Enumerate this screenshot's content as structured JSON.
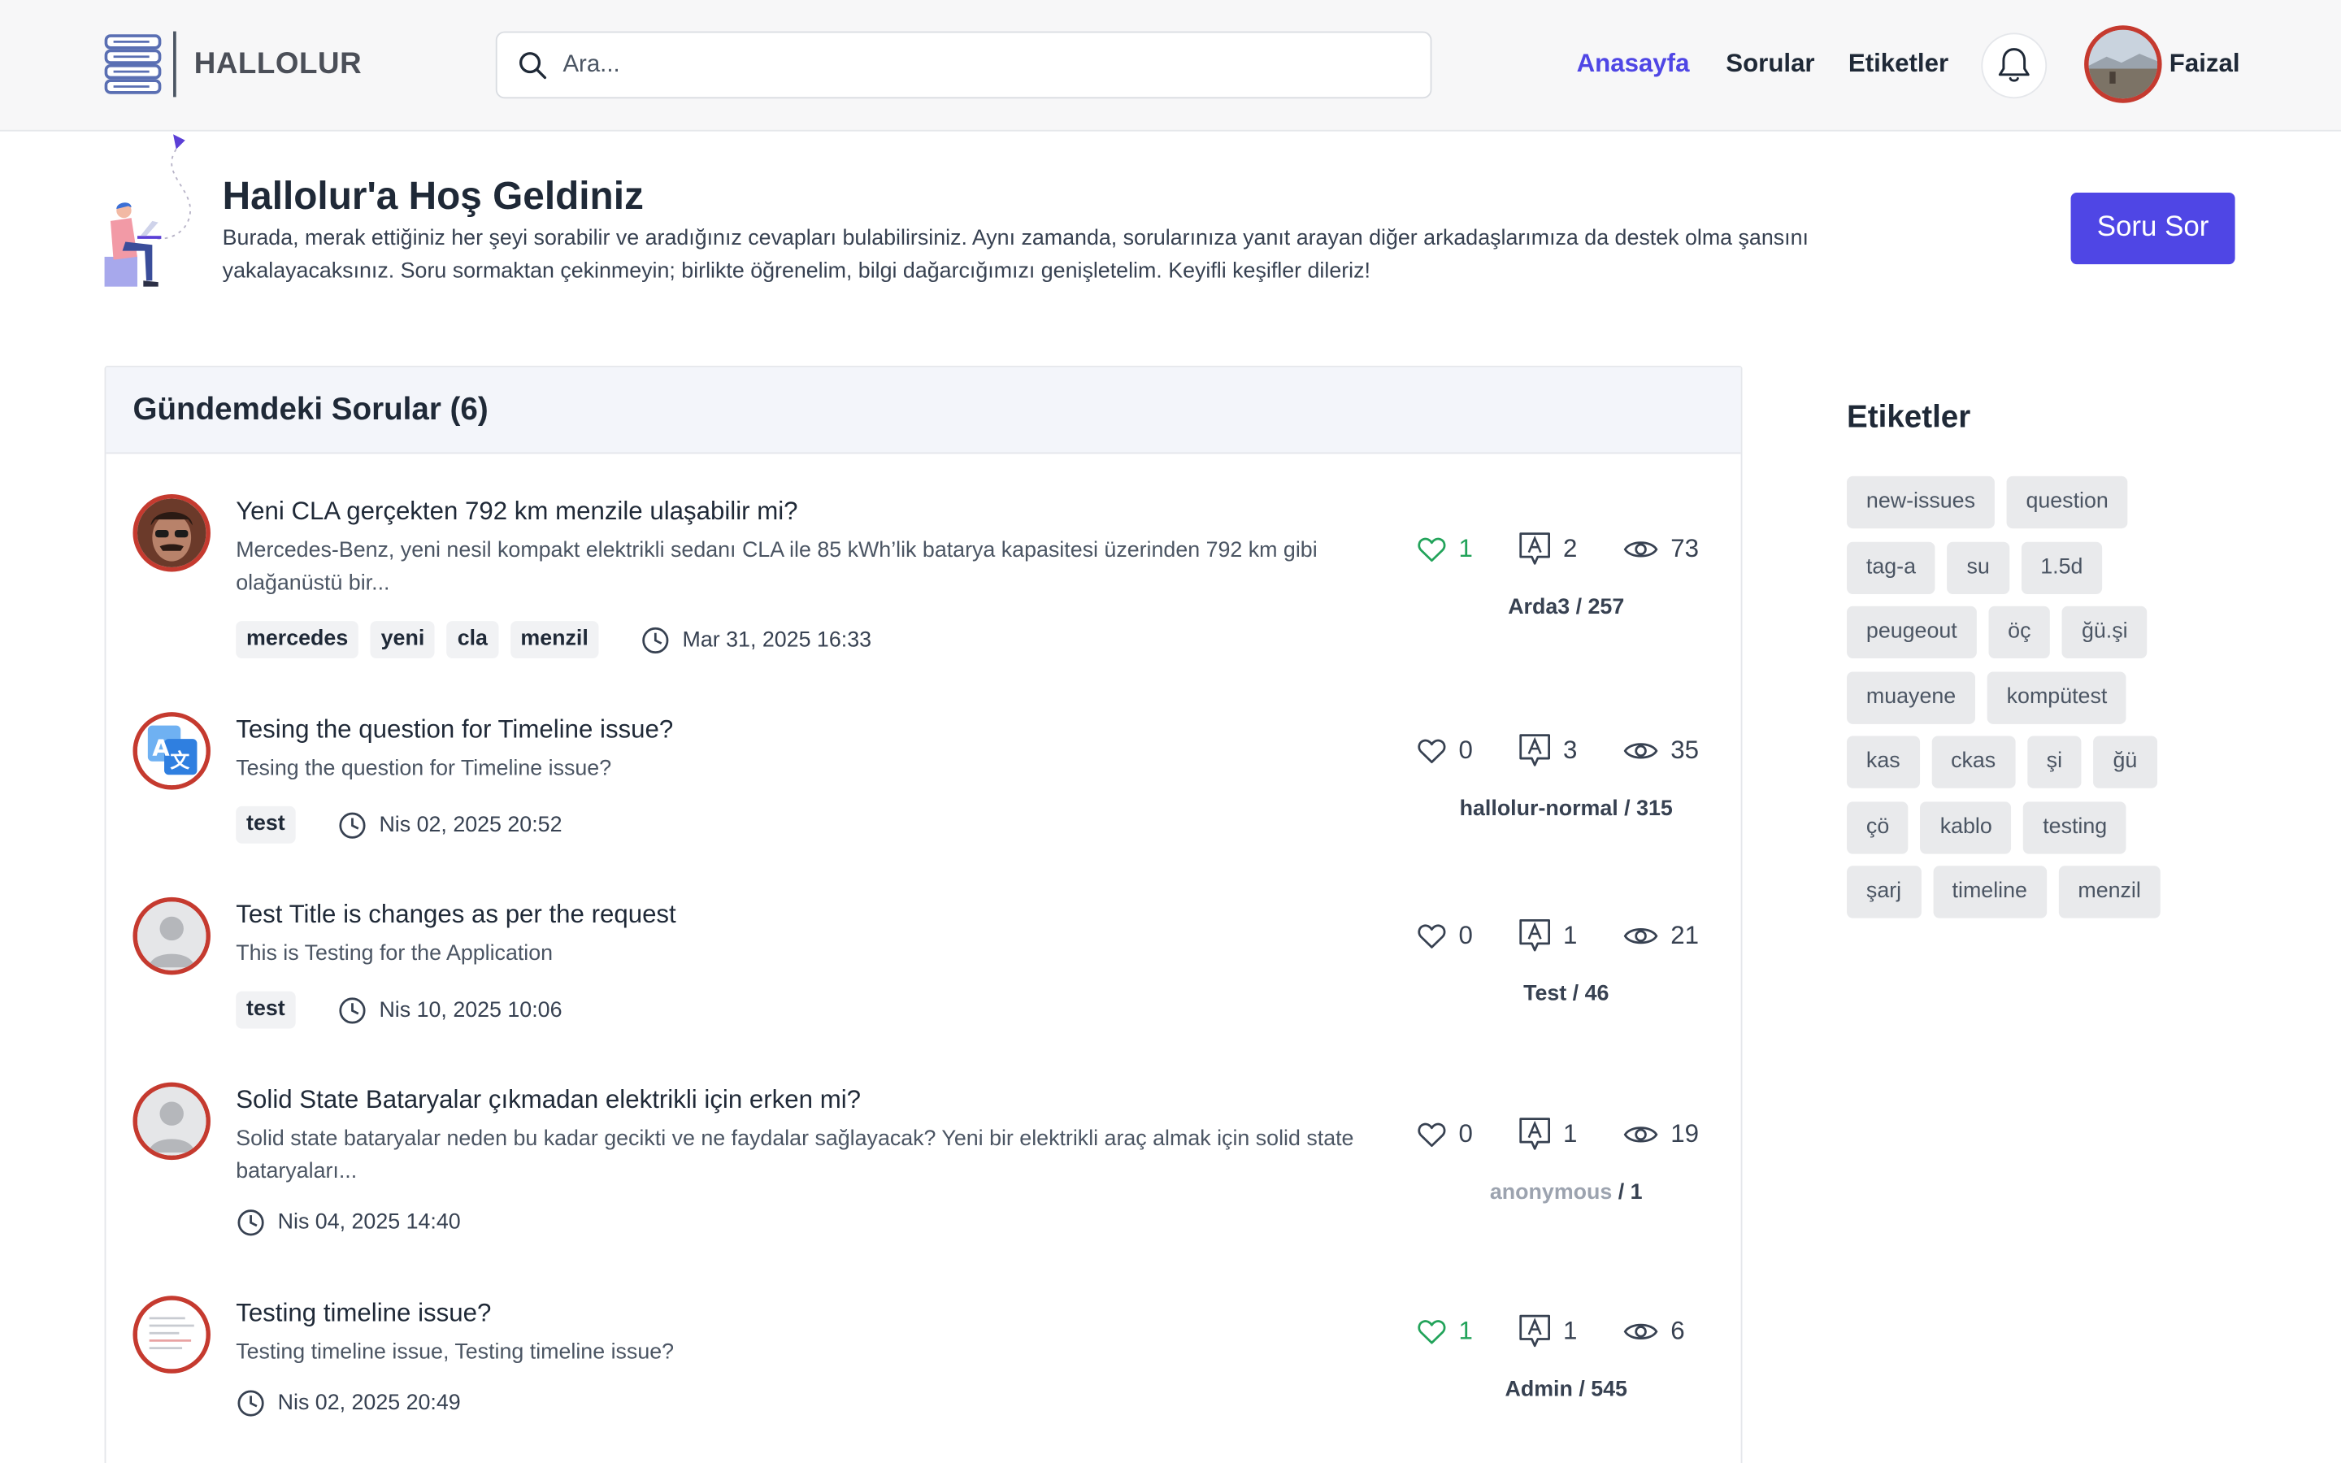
{
  "header": {
    "brand": "HALLOLUR",
    "search_placeholder": "Ara...",
    "nav": [
      {
        "label": "Anasayfa",
        "active": true
      },
      {
        "label": "Sorular",
        "active": false
      },
      {
        "label": "Etiketler",
        "active": false
      }
    ],
    "user_name": "Faizal"
  },
  "hero": {
    "title": "Hallolur'a Hoş Geldiniz",
    "text": "Burada, merak ettiğiniz her şeyi sorabilir ve aradığınız cevapları bulabilirsiniz. Aynı zamanda, sorularınıza yanıt arayan diğer arkadaşlarımıza da destek olma şansını yakalayacaksınız. Soru sormaktan çekinmeyin; birlikte öğrenelim, bilgi dağarcığımızı genişletelim. Keyifli keşifler dileriz!",
    "ask_button": "Soru Sor"
  },
  "questions_panel": {
    "title": "Gündemdeki Sorular (6)",
    "items": [
      {
        "title": "Yeni CLA gerçekten 792 km menzile ulaşabilir mi?",
        "excerpt": "Mercedes-Benz, yeni nesil kompakt elektrikli sedanı CLA ile 85 kWh’lik batarya kapasitesi üzerinden 792 km gibi olağanüstü bir...",
        "tags": [
          "mercedes",
          "yeni",
          "cla",
          "menzil"
        ],
        "date": "Mar 31, 2025 16:33",
        "likes": "1",
        "comments": "2",
        "views": "73",
        "author": "Arda3",
        "author_points": " / 257",
        "avatar": "photo"
      },
      {
        "title": "Tesing the question for Timeline issue?",
        "excerpt": "Tesing the question for Timeline issue?",
        "tags": [
          "test"
        ],
        "date": "Nis 02, 2025 20:52",
        "likes": "0",
        "comments": "3",
        "views": "35",
        "author": "hallolur-normal",
        "author_points": " / 315",
        "avatar": "translate-icon"
      },
      {
        "title": "Test Title is changes as per the request",
        "excerpt": "This is Testing for the Application",
        "tags": [
          "test"
        ],
        "date": "Nis 10, 2025 10:06",
        "likes": "0",
        "comments": "1",
        "views": "21",
        "author": "Test",
        "author_points": " / 46",
        "avatar": "default"
      },
      {
        "title": "Solid State Bataryalar çıkmadan elektrikli için erken mi?",
        "excerpt": "Solid state bataryalar neden bu kadar gecikti ve ne faydalar sağlayacak? Yeni bir elektrikli araç almak için solid state bataryaları...",
        "tags": [],
        "date": "Nis 04, 2025 14:40",
        "likes": "0",
        "comments": "1",
        "views": "19",
        "author": "anonymous",
        "author_points": " / 1",
        "avatar": "default"
      },
      {
        "title": "Testing timeline issue?",
        "excerpt": "Testing timeline issue, Testing timeline issue?",
        "tags": [],
        "date": "Nis 02, 2025 20:49",
        "likes": "1",
        "comments": "1",
        "views": "6",
        "author": "Admin",
        "author_points": " / 545",
        "avatar": "document"
      }
    ]
  },
  "sidebar": {
    "title": "Etiketler",
    "tags": [
      "new-issues",
      "question",
      "tag-a",
      "su",
      "1.5d",
      "peugeout",
      "öç",
      "ğü.şi",
      "muayene",
      "kompütest",
      "kas",
      "ckas",
      "şi",
      "ğü",
      "çö",
      "kablo",
      "testing",
      "şarj",
      "timeline",
      "menzil"
    ]
  },
  "colors": {
    "accent": "#4f46e5",
    "avatar_ring": "#c53a2f",
    "like_active": "#22a35a"
  }
}
